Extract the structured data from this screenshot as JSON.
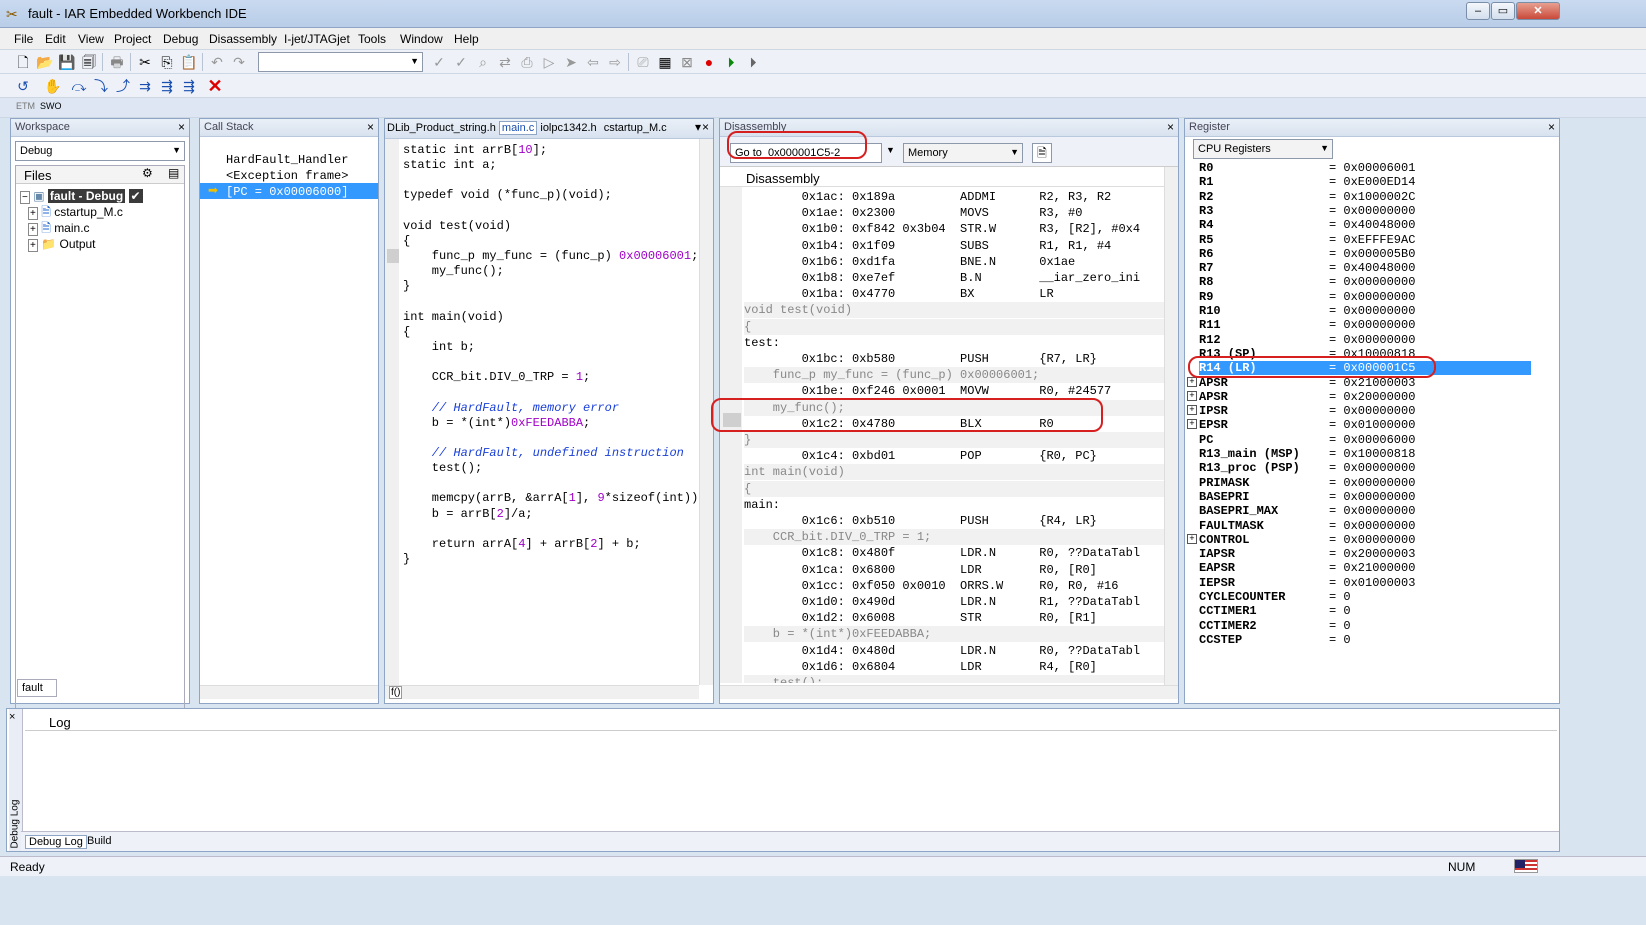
{
  "window": {
    "title": "fault - IAR Embedded Workbench IDE"
  },
  "menu": [
    "File",
    "Edit",
    "View",
    "Project",
    "Debug",
    "Disassembly",
    "I-jet/JTAGjet",
    "Tools",
    "Window",
    "Help"
  ],
  "toolbar": {
    "mode_tabs": [
      "ETM",
      "SWO"
    ]
  },
  "workspace": {
    "title": "Workspace",
    "config": "Debug",
    "files_header": "Files",
    "project": "fault - Debug",
    "project_check": "✔",
    "items": [
      "cstartup_M.c",
      "main.c",
      "Output"
    ],
    "tab": "fault"
  },
  "callstack": {
    "title": "Call Stack",
    "frames": [
      "HardFault_Handler",
      "<Exception frame>",
      "[PC = 0x00006000]"
    ]
  },
  "editor": {
    "tabs": [
      "DLib_Product_string.h",
      "main.c",
      "iolpc1342.h",
      "cstartup_M.c"
    ],
    "lines": [
      {
        "t": "static int arrB[",
        "n": "10",
        "t2": "];"
      },
      {
        "t": "static int a;"
      },
      {
        "t": ""
      },
      {
        "t": "typedef void (*func_p)(void);"
      },
      {
        "t": ""
      },
      {
        "t": "void test(void)"
      },
      {
        "t": "{"
      },
      {
        "t": "    func_p my_func = (func_p) ",
        "n": "0x00006001",
        "t2": ";"
      },
      {
        "t": "    my_func();"
      },
      {
        "t": "}"
      },
      {
        "t": ""
      },
      {
        "t": "int main(void)"
      },
      {
        "t": "{"
      },
      {
        "t": "    int b;"
      },
      {
        "t": ""
      },
      {
        "t": "    CCR_bit.DIV_0_TRP = ",
        "n": "1",
        "t2": ";"
      },
      {
        "t": ""
      },
      {
        "c": "    // HardFault, memory error"
      },
      {
        "t": "    b = *(int*)",
        "n": "0xFEEDABBA",
        "t2": ";"
      },
      {
        "t": ""
      },
      {
        "c": "    // HardFault, undefined instruction"
      },
      {
        "t": "    test();"
      },
      {
        "t": ""
      },
      {
        "t": "    memcpy(arrB, &arrA[",
        "n": "1",
        "t2": "], ",
        "n2": "9",
        "t3": "*sizeof(int));"
      },
      {
        "t": "    b = arrB[",
        "n": "2",
        "t2": "]/a;"
      },
      {
        "t": ""
      },
      {
        "t": "    return arrA[",
        "n": "4",
        "t2": "] + arrB[",
        "n2": "2",
        "t3": "] + b;"
      },
      {
        "t": "}"
      }
    ],
    "bottom_icon": "f()"
  },
  "disassembly": {
    "title": "Disassembly",
    "goto_label": "Go to",
    "goto_value": "0x000001C5-2",
    "memory": "Memory",
    "header": "Disassembly",
    "rows": [
      {
        "k": "i",
        "text": "        0x1ac: 0x189a         ADDMI      R2, R3, R2"
      },
      {
        "k": "i",
        "text": "        0x1ae: 0x2300         MOVS       R3, #0"
      },
      {
        "k": "i",
        "text": "        0x1b0: 0xf842 0x3b04  STR.W      R3, [R2], #0x4"
      },
      {
        "k": "i",
        "text": "        0x1b4: 0x1f09         SUBS       R1, R1, #4"
      },
      {
        "k": "i",
        "text": "        0x1b6: 0xd1fa         BNE.N      0x1ae"
      },
      {
        "k": "i",
        "text": "        0x1b8: 0xe7ef         B.N        __iar_zero_ini"
      },
      {
        "k": "i",
        "text": "        0x1ba: 0x4770         BX         LR"
      },
      {
        "k": "s",
        "text": "void test(void)"
      },
      {
        "k": "s",
        "text": "{"
      },
      {
        "k": "l",
        "text": "test:"
      },
      {
        "k": "i",
        "text": "        0x1bc: 0xb580         PUSH       {R7, LR}"
      },
      {
        "k": "s",
        "text": "    func_p my_func = (func_p) 0x00006001;"
      },
      {
        "k": "i",
        "text": "        0x1be: 0xf246 0x0001  MOVW       R0, #24577"
      },
      {
        "k": "s",
        "text": "    my_func();"
      },
      {
        "k": "i",
        "text": "        0x1c2: 0x4780         BLX        R0"
      },
      {
        "k": "s",
        "text": "}"
      },
      {
        "k": "i",
        "text": "        0x1c4: 0xbd01         POP        {R0, PC}"
      },
      {
        "k": "s",
        "text": "int main(void)"
      },
      {
        "k": "s",
        "text": "{"
      },
      {
        "k": "l",
        "text": "main:"
      },
      {
        "k": "i",
        "text": "        0x1c6: 0xb510         PUSH       {R4, LR}"
      },
      {
        "k": "s",
        "text": "    CCR_bit.DIV_0_TRP = 1;"
      },
      {
        "k": "i",
        "text": "        0x1c8: 0x480f         LDR.N      R0, ??DataTabl"
      },
      {
        "k": "i",
        "text": "        0x1ca: 0x6800         LDR        R0, [R0]"
      },
      {
        "k": "i",
        "text": "        0x1cc: 0xf050 0x0010  ORRS.W     R0, R0, #16"
      },
      {
        "k": "i",
        "text": "        0x1d0: 0x490d         LDR.N      R1, ??DataTabl"
      },
      {
        "k": "i",
        "text": "        0x1d2: 0x6008         STR        R0, [R1]"
      },
      {
        "k": "s",
        "text": "    b = *(int*)0xFEEDABBA;"
      },
      {
        "k": "i",
        "text": "        0x1d4: 0x480d         LDR.N      R0, ??DataTabl"
      },
      {
        "k": "i",
        "text": "        0x1d6: 0x6804         LDR        R4, [R0]"
      },
      {
        "k": "s",
        "text": "    test();"
      }
    ]
  },
  "registers": {
    "title": "Register",
    "group": "CPU Registers",
    "rows": [
      {
        "n": "R0",
        "v": "= 0x00006001"
      },
      {
        "n": "R1",
        "v": "= 0xE000ED14"
      },
      {
        "n": "R2",
        "v": "= 0x1000002C"
      },
      {
        "n": "R3",
        "v": "= 0x00000000"
      },
      {
        "n": "R4",
        "v": "= 0x40048000"
      },
      {
        "n": "R5",
        "v": "= 0xEFFFE9AC"
      },
      {
        "n": "R6",
        "v": "= 0x000005B0"
      },
      {
        "n": "R7",
        "v": "= 0x40048000"
      },
      {
        "n": "R8",
        "v": "= 0x00000000"
      },
      {
        "n": "R9",
        "v": "= 0x00000000"
      },
      {
        "n": "R10",
        "v": "= 0x00000000"
      },
      {
        "n": "R11",
        "v": "= 0x00000000"
      },
      {
        "n": "R12",
        "v": "= 0x00000000"
      },
      {
        "n": "R13 (SP)",
        "v": "= 0x10000818"
      },
      {
        "n": "R14 (LR)",
        "v": "= 0x000001C5"
      },
      {
        "n": "APSR",
        "v": "= 0x21000003"
      },
      {
        "n": "APSR",
        "v": "= 0x20000000"
      },
      {
        "n": "IPSR",
        "v": "= 0x00000000"
      },
      {
        "n": "EPSR",
        "v": "= 0x01000000"
      },
      {
        "n": "PC",
        "v": "= 0x00006000"
      },
      {
        "n": "R13_main (MSP)",
        "v": "= 0x10000818"
      },
      {
        "n": "R13_proc (PSP)",
        "v": "= 0x00000000"
      },
      {
        "n": "PRIMASK",
        "v": "= 0x00000000"
      },
      {
        "n": "BASEPRI",
        "v": "= 0x00000000"
      },
      {
        "n": "BASEPRI_MAX",
        "v": "= 0x00000000"
      },
      {
        "n": "FAULTMASK",
        "v": "= 0x00000000"
      },
      {
        "n": "CONTROL",
        "v": "= 0x00000000"
      },
      {
        "n": "IAPSR",
        "v": "= 0x20000003"
      },
      {
        "n": "EAPSR",
        "v": "= 0x21000000"
      },
      {
        "n": "IEPSR",
        "v": "= 0x01000003"
      },
      {
        "n": "CYCLECOUNTER",
        "v": "= 0"
      },
      {
        "n": "CCTIMER1",
        "v": "= 0"
      },
      {
        "n": "CCTIMER2",
        "v": "= 0"
      },
      {
        "n": "CCSTEP",
        "v": "= 0"
      }
    ],
    "selected_index": 14,
    "expandable": [
      15,
      16,
      17,
      18,
      26
    ]
  },
  "log": {
    "side_label": "Debug Log",
    "header": "Log",
    "tabs": [
      "Debug Log",
      "Build"
    ]
  },
  "status": {
    "left": "Ready",
    "num": "NUM"
  },
  "colors": {
    "highlight": "#d62020",
    "selection": "#3399ff"
  }
}
